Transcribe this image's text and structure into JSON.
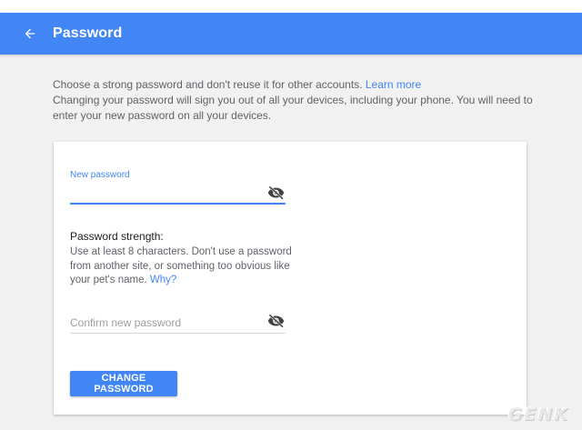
{
  "header": {
    "title": "Password",
    "back_icon": "arrow-back-icon",
    "color": "#4285f4"
  },
  "intro": {
    "line1_text": "Choose a strong password and don't reuse it for other accounts.",
    "learn_more": "Learn more",
    "line2_text": "Changing your password will sign you out of all your devices, including your phone. You will need to enter your new password on all your devices."
  },
  "form": {
    "new_password_label": "New password",
    "new_password_value": "",
    "new_password_visibility_icon": "visibility-off-icon",
    "strength_title": "Password strength:",
    "strength_text": "Use at least 8 characters. Don't use a password from another site, or something too obvious like your pet's name.",
    "why_link": "Why?",
    "confirm_placeholder": "Confirm new password",
    "confirm_value": "",
    "confirm_visibility_icon": "visibility-off-icon",
    "submit_label": "CHANGE PASSWORD"
  },
  "watermark": "GENK",
  "colors": {
    "accent": "#4285f4",
    "page_bg": "#f1f1f1",
    "card_bg": "#ffffff",
    "muted_text": "#5f6368"
  }
}
